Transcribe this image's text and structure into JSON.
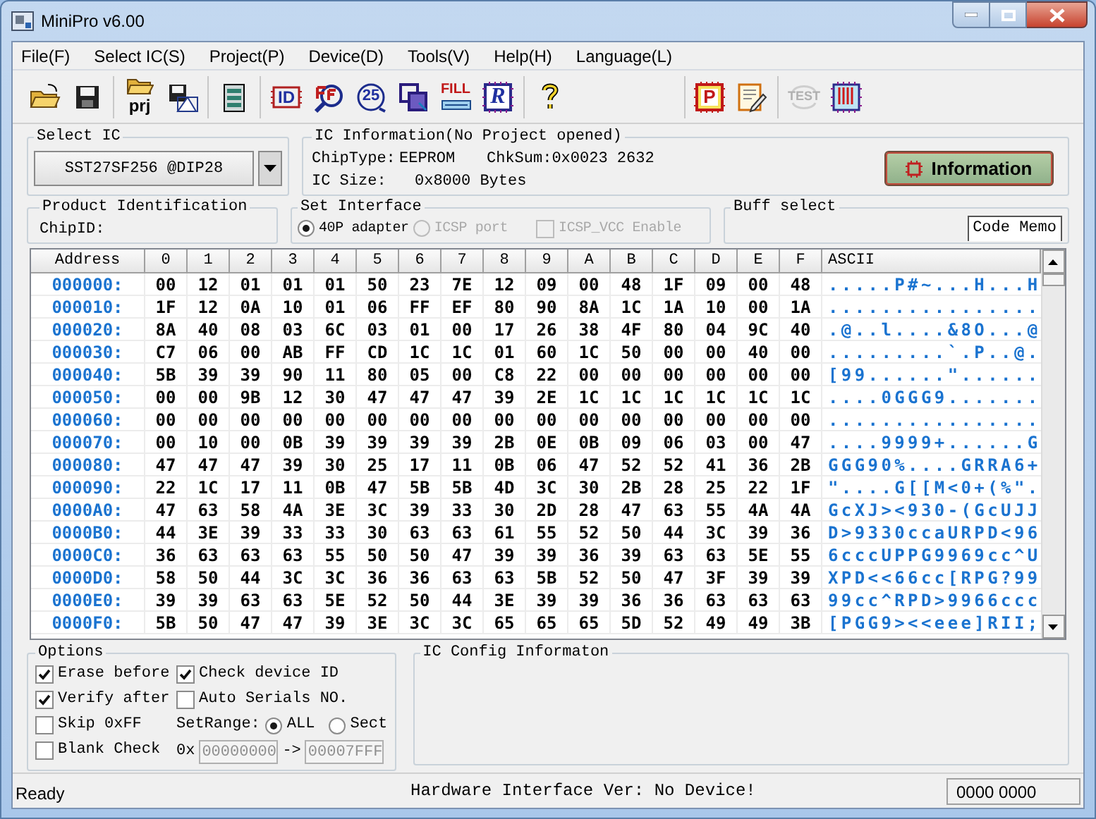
{
  "window": {
    "title": "MiniPro v6.00"
  },
  "menu": [
    "File(F)",
    "Select IC(S)",
    "Project(P)",
    "Device(D)",
    "Tools(V)",
    "Help(H)",
    "Language(L)"
  ],
  "toolbar": [
    [
      {
        "kind": "open"
      },
      {
        "kind": "save"
      }
    ],
    [
      {
        "kind": "project",
        "text": "prj"
      },
      {
        "kind": "save-image"
      }
    ],
    [
      {
        "kind": "memory"
      }
    ],
    [
      {
        "kind": "chip-id",
        "text": "ID"
      },
      {
        "kind": "magnifier"
      },
      {
        "kind": "circle",
        "text": "25"
      },
      {
        "kind": "select"
      },
      {
        "kind": "fill",
        "text": "FILL"
      },
      {
        "kind": "chip-letter",
        "text": "R"
      }
    ],
    [
      {
        "kind": "help"
      }
    ],
    [
      {
        "kind": "chip-program",
        "text": "P"
      },
      {
        "kind": "notepad"
      }
    ],
    [
      {
        "kind": "test",
        "text": "TEST",
        "disabled": true
      },
      {
        "kind": "chip-pins"
      }
    ]
  ],
  "select_ic": {
    "label": "Select IC",
    "value": "SST27SF256 @DIP28"
  },
  "ic_information": {
    "label": "IC Information(No Project opened)",
    "chip_type_label": "ChipType:",
    "chip_type": "EEPROM",
    "checksum": "ChkSum:0x0023 2632",
    "size_label": "IC Size:",
    "size": "0x8000 Bytes",
    "button": "Information"
  },
  "product_identification": {
    "label": "Product Identification",
    "chip_id_label": "ChipID:"
  },
  "set_interface": {
    "label": "Set Interface",
    "radios": [
      {
        "label": "40P adapter",
        "selected": true,
        "disabled": false
      },
      {
        "label": "ICSP port",
        "selected": false,
        "disabled": true
      }
    ],
    "vcc": {
      "label": "ICSP_VCC Enable",
      "checked": false,
      "disabled": true
    }
  },
  "buff_select": {
    "label": "Buff select",
    "tabs": [
      {
        "label": "Code Memo",
        "selected": true
      }
    ]
  },
  "hex_table": {
    "columns": [
      "Address",
      "0",
      "1",
      "2",
      "3",
      "4",
      "5",
      "6",
      "7",
      "8",
      "9",
      "A",
      "B",
      "C",
      "D",
      "E",
      "F",
      "ASCII"
    ],
    "rows": [
      {
        "address": "000000:",
        "bytes": [
          "00",
          "12",
          "01",
          "01",
          "01",
          "50",
          "23",
          "7E",
          "12",
          "09",
          "00",
          "48",
          "1F",
          "09",
          "00",
          "48"
        ],
        "ascii": ".....P#~...H...H"
      },
      {
        "address": "000010:",
        "bytes": [
          "1F",
          "12",
          "0A",
          "10",
          "01",
          "06",
          "FF",
          "EF",
          "80",
          "90",
          "8A",
          "1C",
          "1A",
          "10",
          "00",
          "1A"
        ],
        "ascii": "................"
      },
      {
        "address": "000020:",
        "bytes": [
          "8A",
          "40",
          "08",
          "03",
          "6C",
          "03",
          "01",
          "00",
          "17",
          "26",
          "38",
          "4F",
          "80",
          "04",
          "9C",
          "40"
        ],
        "ascii": ".@..l....&8O...@"
      },
      {
        "address": "000030:",
        "bytes": [
          "C7",
          "06",
          "00",
          "AB",
          "FF",
          "CD",
          "1C",
          "1C",
          "01",
          "60",
          "1C",
          "50",
          "00",
          "00",
          "40",
          "00"
        ],
        "ascii": ".........`.P..@."
      },
      {
        "address": "000040:",
        "bytes": [
          "5B",
          "39",
          "39",
          "90",
          "11",
          "80",
          "05",
          "00",
          "C8",
          "22",
          "00",
          "00",
          "00",
          "00",
          "00",
          "00"
        ],
        "ascii": "[99......\"......"
      },
      {
        "address": "000050:",
        "bytes": [
          "00",
          "00",
          "9B",
          "12",
          "30",
          "47",
          "47",
          "47",
          "39",
          "2E",
          "1C",
          "1C",
          "1C",
          "1C",
          "1C",
          "1C"
        ],
        "ascii": "....0GGG9......."
      },
      {
        "address": "000060:",
        "bytes": [
          "00",
          "00",
          "00",
          "00",
          "00",
          "00",
          "00",
          "00",
          "00",
          "00",
          "00",
          "00",
          "00",
          "00",
          "00",
          "00"
        ],
        "ascii": "................"
      },
      {
        "address": "000070:",
        "bytes": [
          "00",
          "10",
          "00",
          "0B",
          "39",
          "39",
          "39",
          "39",
          "2B",
          "0E",
          "0B",
          "09",
          "06",
          "03",
          "00",
          "47"
        ],
        "ascii": "....9999+......G"
      },
      {
        "address": "000080:",
        "bytes": [
          "47",
          "47",
          "47",
          "39",
          "30",
          "25",
          "17",
          "11",
          "0B",
          "06",
          "47",
          "52",
          "52",
          "41",
          "36",
          "2B"
        ],
        "ascii": "GGG90%....GRRA6+"
      },
      {
        "address": "000090:",
        "bytes": [
          "22",
          "1C",
          "17",
          "11",
          "0B",
          "47",
          "5B",
          "5B",
          "4D",
          "3C",
          "30",
          "2B",
          "28",
          "25",
          "22",
          "1F"
        ],
        "ascii": "\"....G[[M<0+(%\"."
      },
      {
        "address": "0000A0:",
        "bytes": [
          "47",
          "63",
          "58",
          "4A",
          "3E",
          "3C",
          "39",
          "33",
          "30",
          "2D",
          "28",
          "47",
          "63",
          "55",
          "4A",
          "4A"
        ],
        "ascii": "GcXJ><930-(GcUJJ"
      },
      {
        "address": "0000B0:",
        "bytes": [
          "44",
          "3E",
          "39",
          "33",
          "33",
          "30",
          "63",
          "63",
          "61",
          "55",
          "52",
          "50",
          "44",
          "3C",
          "39",
          "36"
        ],
        "ascii": "D>9330ccaURPD<96"
      },
      {
        "address": "0000C0:",
        "bytes": [
          "36",
          "63",
          "63",
          "63",
          "55",
          "50",
          "50",
          "47",
          "39",
          "39",
          "36",
          "39",
          "63",
          "63",
          "5E",
          "55"
        ],
        "ascii": "6cccUPPG9969cc^U"
      },
      {
        "address": "0000D0:",
        "bytes": [
          "58",
          "50",
          "44",
          "3C",
          "3C",
          "36",
          "36",
          "63",
          "63",
          "5B",
          "52",
          "50",
          "47",
          "3F",
          "39",
          "39"
        ],
        "ascii": "XPD<<66cc[RPG?99"
      },
      {
        "address": "0000E0:",
        "bytes": [
          "39",
          "39",
          "63",
          "63",
          "5E",
          "52",
          "50",
          "44",
          "3E",
          "39",
          "39",
          "36",
          "36",
          "63",
          "63",
          "63"
        ],
        "ascii": "99cc^RPD>9966ccc"
      },
      {
        "address": "0000F0:",
        "bytes": [
          "5B",
          "50",
          "47",
          "47",
          "39",
          "3E",
          "3C",
          "3C",
          "65",
          "65",
          "65",
          "5D",
          "52",
          "49",
          "49",
          "3B"
        ],
        "ascii": "[PGG9><<eee]RII;"
      }
    ]
  },
  "options": {
    "label": "Options",
    "checks": [
      {
        "label": "Erase before",
        "checked": true
      },
      {
        "label": "Check device ID",
        "checked": true
      },
      {
        "label": "Verify after",
        "checked": true
      },
      {
        "label": "Auto Serials NO.",
        "checked": false
      },
      {
        "label": "Skip 0xFF",
        "checked": false
      },
      {
        "label": "Blank Check",
        "checked": false
      }
    ],
    "set_range": {
      "label": "SetRange:",
      "choices": [
        {
          "label": "ALL",
          "selected": true
        },
        {
          "label": "Sect",
          "selected": false
        }
      ],
      "prefix": "0x",
      "from": "00000000",
      "arrow": "->",
      "to": "00007FFF"
    }
  },
  "ic_config": {
    "label": "IC Config Informaton"
  },
  "status_bar": {
    "status": "Ready",
    "hardware": "Hardware Interface Ver: No Device!",
    "counter": "0000 0000"
  }
}
